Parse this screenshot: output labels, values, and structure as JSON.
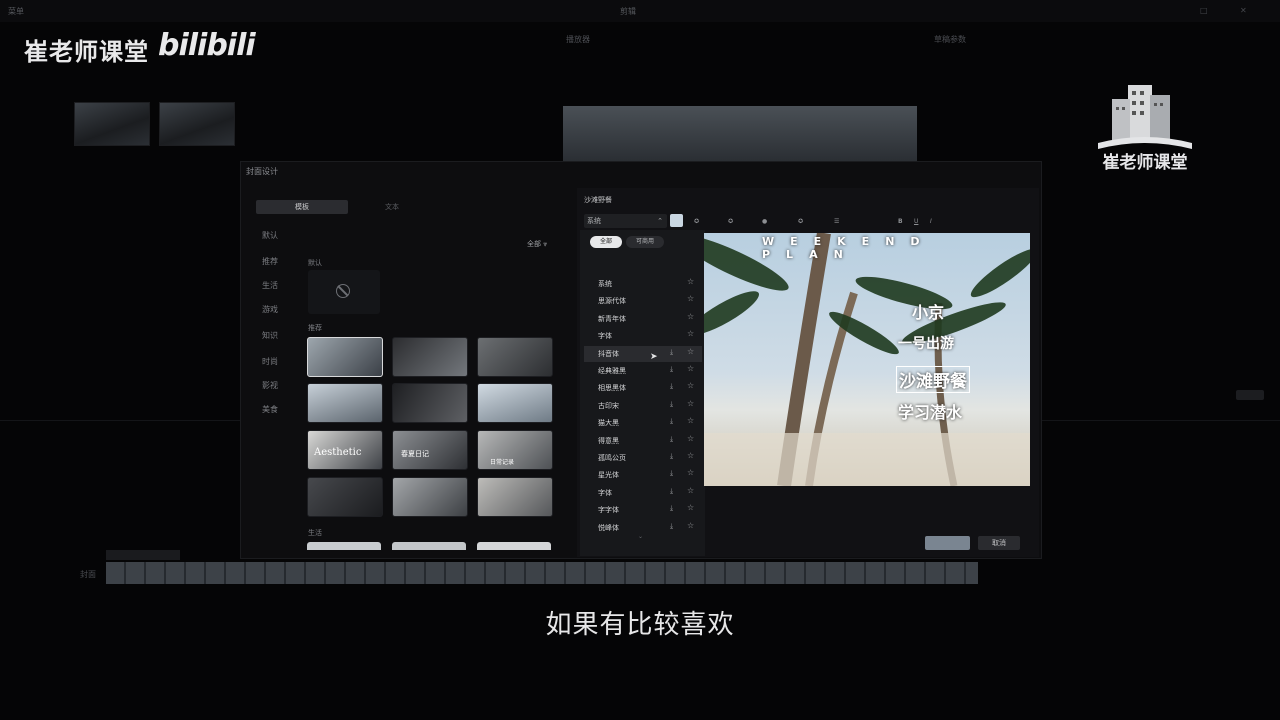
{
  "app": {
    "menu_label": "菜单",
    "window_title": "剪辑"
  },
  "watermark": {
    "channel": "崔老师课堂",
    "platform": "bilibili",
    "logo_text": "崔老师课堂"
  },
  "background_panels": {
    "player_label": "播放器",
    "properties_label": "草稿参数",
    "timeline_track_label": "封面"
  },
  "dialog": {
    "title": "封面设计",
    "tabs": [
      "模板",
      "文本"
    ],
    "categories": [
      "默认",
      "推荐",
      "生活",
      "游戏",
      "知识",
      "时尚",
      "影视",
      "美食"
    ],
    "filter_label": "全部",
    "sections": {
      "default": "默认",
      "recommended": "推荐",
      "life": "生活"
    },
    "template_texts": [
      "Aesthetic",
      "春夏日记",
      "日常记录"
    ],
    "cancel_label": "取消"
  },
  "text_editor": {
    "text_value": "沙滩野餐",
    "font_select": "系统",
    "toolbar": [
      "预设",
      "描边",
      "背景",
      "气泡",
      "排列",
      "对齐",
      "B",
      "U",
      "I"
    ],
    "filter_all": "全部",
    "filter_commercial": "可商用",
    "fonts": [
      "系统",
      "思源代体",
      "新青年体",
      "字体",
      "抖音体",
      "经典雅黑",
      "相思黑体",
      "古印宋",
      "猫大黑",
      "得意黑",
      "孤鸣公页",
      "星光体",
      "字体",
      "字字体",
      "悦峰体"
    ],
    "selected_font_index": 4
  },
  "preview": {
    "header_text": "WEEKEND PLAN",
    "lines": [
      "小京",
      "一号出游",
      "沙滩野餐",
      "学习潜水"
    ]
  },
  "subtitle": "如果有比较喜欢"
}
